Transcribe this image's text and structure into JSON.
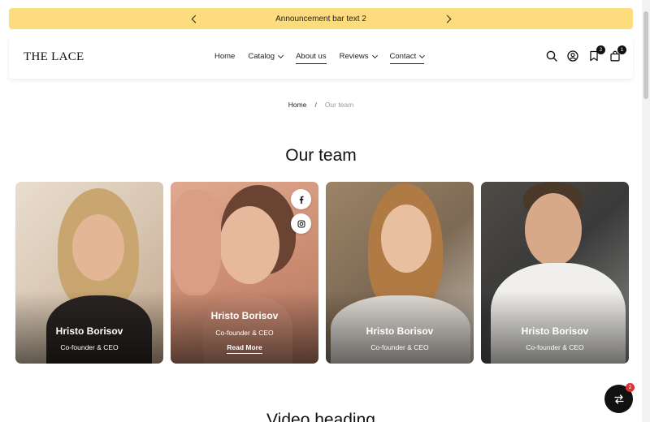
{
  "announcement": {
    "text": "Announcement bar text 2",
    "background": "#fddc7e"
  },
  "header": {
    "logo": "THE LACE",
    "nav": [
      {
        "label": "Home",
        "has_dropdown": false
      },
      {
        "label": "Catalog",
        "has_dropdown": true
      },
      {
        "label": "About us",
        "has_dropdown": false,
        "active": true
      },
      {
        "label": "Reviews",
        "has_dropdown": true
      },
      {
        "label": "Contact",
        "has_dropdown": true,
        "active": true
      }
    ],
    "icons": {
      "search": "search-icon",
      "account": "user-icon",
      "wishlist": "bookmark-icon",
      "cart": "bag-icon"
    },
    "wishlist_count": "2",
    "cart_count": "1"
  },
  "breadcrumb": {
    "home": "Home",
    "separator": "/",
    "current": "Our team"
  },
  "section": {
    "title": "Our team"
  },
  "team": [
    {
      "name": "Hristo Borisov",
      "role": "Co-founder & CEO"
    },
    {
      "name": "Hristo Borisov",
      "role": "Co-founder & CEO",
      "read_more": "Read More"
    },
    {
      "name": "Hristo Borisov",
      "role": "Co-founder & CEO"
    },
    {
      "name": "Hristo Borisov",
      "role": "Co-founder & CEO"
    }
  ],
  "compare": {
    "count": "2",
    "icon": "compare-arrows-icon"
  },
  "next_section": {
    "title": "Video heading"
  }
}
